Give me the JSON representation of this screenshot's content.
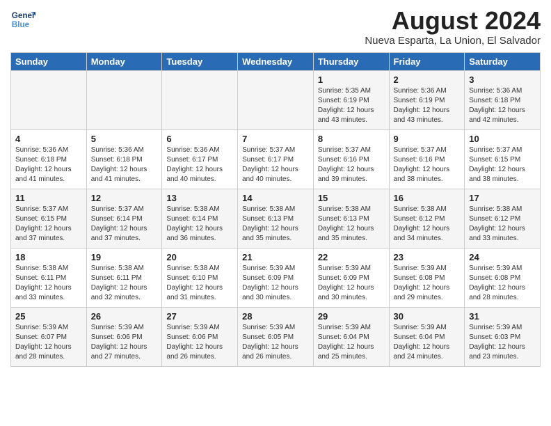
{
  "header": {
    "logo_line1": "General",
    "logo_line2": "Blue",
    "month_year": "August 2024",
    "location": "Nueva Esparta, La Union, El Salvador"
  },
  "weekdays": [
    "Sunday",
    "Monday",
    "Tuesday",
    "Wednesday",
    "Thursday",
    "Friday",
    "Saturday"
  ],
  "weeks": [
    [
      {
        "day": "",
        "info": ""
      },
      {
        "day": "",
        "info": ""
      },
      {
        "day": "",
        "info": ""
      },
      {
        "day": "",
        "info": ""
      },
      {
        "day": "1",
        "info": "Sunrise: 5:35 AM\nSunset: 6:19 PM\nDaylight: 12 hours\nand 43 minutes."
      },
      {
        "day": "2",
        "info": "Sunrise: 5:36 AM\nSunset: 6:19 PM\nDaylight: 12 hours\nand 43 minutes."
      },
      {
        "day": "3",
        "info": "Sunrise: 5:36 AM\nSunset: 6:18 PM\nDaylight: 12 hours\nand 42 minutes."
      }
    ],
    [
      {
        "day": "4",
        "info": "Sunrise: 5:36 AM\nSunset: 6:18 PM\nDaylight: 12 hours\nand 41 minutes."
      },
      {
        "day": "5",
        "info": "Sunrise: 5:36 AM\nSunset: 6:18 PM\nDaylight: 12 hours\nand 41 minutes."
      },
      {
        "day": "6",
        "info": "Sunrise: 5:36 AM\nSunset: 6:17 PM\nDaylight: 12 hours\nand 40 minutes."
      },
      {
        "day": "7",
        "info": "Sunrise: 5:37 AM\nSunset: 6:17 PM\nDaylight: 12 hours\nand 40 minutes."
      },
      {
        "day": "8",
        "info": "Sunrise: 5:37 AM\nSunset: 6:16 PM\nDaylight: 12 hours\nand 39 minutes."
      },
      {
        "day": "9",
        "info": "Sunrise: 5:37 AM\nSunset: 6:16 PM\nDaylight: 12 hours\nand 38 minutes."
      },
      {
        "day": "10",
        "info": "Sunrise: 5:37 AM\nSunset: 6:15 PM\nDaylight: 12 hours\nand 38 minutes."
      }
    ],
    [
      {
        "day": "11",
        "info": "Sunrise: 5:37 AM\nSunset: 6:15 PM\nDaylight: 12 hours\nand 37 minutes."
      },
      {
        "day": "12",
        "info": "Sunrise: 5:37 AM\nSunset: 6:14 PM\nDaylight: 12 hours\nand 37 minutes."
      },
      {
        "day": "13",
        "info": "Sunrise: 5:38 AM\nSunset: 6:14 PM\nDaylight: 12 hours\nand 36 minutes."
      },
      {
        "day": "14",
        "info": "Sunrise: 5:38 AM\nSunset: 6:13 PM\nDaylight: 12 hours\nand 35 minutes."
      },
      {
        "day": "15",
        "info": "Sunrise: 5:38 AM\nSunset: 6:13 PM\nDaylight: 12 hours\nand 35 minutes."
      },
      {
        "day": "16",
        "info": "Sunrise: 5:38 AM\nSunset: 6:12 PM\nDaylight: 12 hours\nand 34 minutes."
      },
      {
        "day": "17",
        "info": "Sunrise: 5:38 AM\nSunset: 6:12 PM\nDaylight: 12 hours\nand 33 minutes."
      }
    ],
    [
      {
        "day": "18",
        "info": "Sunrise: 5:38 AM\nSunset: 6:11 PM\nDaylight: 12 hours\nand 33 minutes."
      },
      {
        "day": "19",
        "info": "Sunrise: 5:38 AM\nSunset: 6:11 PM\nDaylight: 12 hours\nand 32 minutes."
      },
      {
        "day": "20",
        "info": "Sunrise: 5:38 AM\nSunset: 6:10 PM\nDaylight: 12 hours\nand 31 minutes."
      },
      {
        "day": "21",
        "info": "Sunrise: 5:39 AM\nSunset: 6:09 PM\nDaylight: 12 hours\nand 30 minutes."
      },
      {
        "day": "22",
        "info": "Sunrise: 5:39 AM\nSunset: 6:09 PM\nDaylight: 12 hours\nand 30 minutes."
      },
      {
        "day": "23",
        "info": "Sunrise: 5:39 AM\nSunset: 6:08 PM\nDaylight: 12 hours\nand 29 minutes."
      },
      {
        "day": "24",
        "info": "Sunrise: 5:39 AM\nSunset: 6:08 PM\nDaylight: 12 hours\nand 28 minutes."
      }
    ],
    [
      {
        "day": "25",
        "info": "Sunrise: 5:39 AM\nSunset: 6:07 PM\nDaylight: 12 hours\nand 28 minutes."
      },
      {
        "day": "26",
        "info": "Sunrise: 5:39 AM\nSunset: 6:06 PM\nDaylight: 12 hours\nand 27 minutes."
      },
      {
        "day": "27",
        "info": "Sunrise: 5:39 AM\nSunset: 6:06 PM\nDaylight: 12 hours\nand 26 minutes."
      },
      {
        "day": "28",
        "info": "Sunrise: 5:39 AM\nSunset: 6:05 PM\nDaylight: 12 hours\nand 26 minutes."
      },
      {
        "day": "29",
        "info": "Sunrise: 5:39 AM\nSunset: 6:04 PM\nDaylight: 12 hours\nand 25 minutes."
      },
      {
        "day": "30",
        "info": "Sunrise: 5:39 AM\nSunset: 6:04 PM\nDaylight: 12 hours\nand 24 minutes."
      },
      {
        "day": "31",
        "info": "Sunrise: 5:39 AM\nSunset: 6:03 PM\nDaylight: 12 hours\nand 23 minutes."
      }
    ]
  ]
}
